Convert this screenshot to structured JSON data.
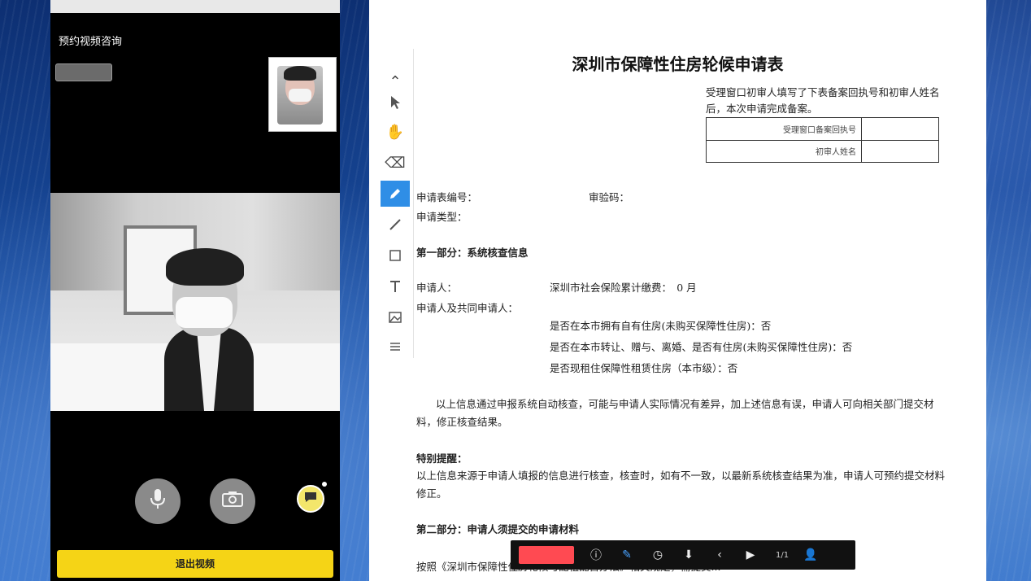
{
  "video_panel": {
    "title": "预约视频咨询",
    "small_button_label": "",
    "red_notice_line1": "",
    "red_notice_line2": "",
    "exit_label": "退出视频"
  },
  "document": {
    "title": "深圳市保障性住房轮候申请表",
    "notice": "受理窗口初审人填写了下表备案回执号和初审人姓名后，本次申请完成备案。",
    "table": {
      "row1_label": "受理窗口备案回执号",
      "row2_label": "初审人姓名"
    },
    "field_form_no": "申请表编号：",
    "field_verify_code": "审验码：",
    "field_type": "申请类型：",
    "section1_title": "第一部分：系统核查信息",
    "applicant": "申请人：",
    "social_insurance": "深圳市社会保险累计缴费：　0 月",
    "co_applicants": "申请人及共同申请人：",
    "q1": "是否在本市拥有自有住房(未购买保障性住房)：否",
    "q2": "是否在本市转让、赠与、离婚、是否有住房(未购买保障性住房)：否",
    "q3": "是否现租住保障性租赁住房（本市级）：否",
    "para1": "以上信息通过申报系统自动核查，可能与申请人实际情况有差异，加上述信息有误，申请人可向相关部门提交材料，修正核查结果。",
    "warn_title": "特别提醒：",
    "para2": "以上信息来源于申请人填报的信息进行核查，核查时，如有不一致，以最新系统核查结果为准，申请人可预约提交材料修正。",
    "section2_title": "第二部分：申请人须提交的申请材料",
    "para3": "按照《深圳市保障性住房轮候与配租配售办法》相关规定，需提交..."
  },
  "player_bar": {
    "rec_label": "",
    "speed_label": "1/1"
  },
  "icons": {
    "mic": "mic-icon",
    "camera": "camera-icon",
    "chat": "chat-icon"
  }
}
